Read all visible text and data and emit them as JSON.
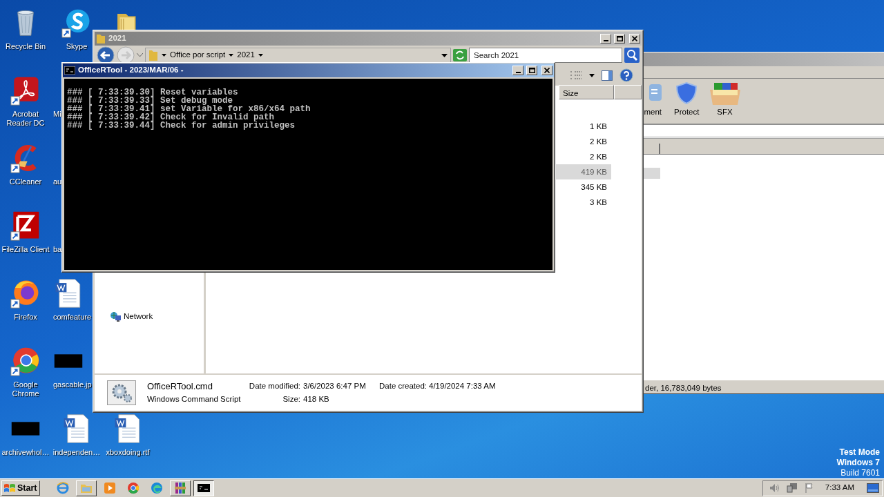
{
  "desktop": {
    "icons": [
      [
        {
          "label": "Recycle Bin",
          "kind": "recycle",
          "shortcut": false,
          "cut": false
        },
        {
          "label": "Skype",
          "kind": "skype",
          "shortcut": true,
          "cut": false
        },
        {
          "kind": "folder",
          "shortcut": false
        }
      ],
      [
        {
          "label": "Acrobat Reader DC",
          "kind": "acrobat",
          "shortcut": true,
          "cut": false
        },
        {
          "label": "Mi",
          "kind": "covered",
          "cut": true
        }
      ],
      [
        {
          "label": "CCleaner",
          "kind": "ccleaner",
          "shortcut": true,
          "cut": false
        },
        {
          "label": "au",
          "kind": "covered",
          "cut": true
        }
      ],
      [
        {
          "label": "FileZilla Client",
          "kind": "filezilla",
          "shortcut": true,
          "cut": false
        },
        {
          "label": "ba",
          "kind": "covered",
          "cut": true
        }
      ],
      [
        {
          "label": "Firefox",
          "kind": "firefox",
          "shortcut": true,
          "cut": false
        },
        {
          "label": "comfeature",
          "kind": "word",
          "shortcut": false,
          "cut": true
        }
      ],
      [
        {
          "label": "Google Chrome",
          "kind": "chrome",
          "shortcut": true,
          "cut": false
        },
        {
          "label": "gascable.jp",
          "kind": "black",
          "shortcut": false,
          "cut": true
        }
      ],
      [
        {
          "label": "archivewhol…",
          "kind": "black",
          "shortcut": false,
          "cut": false
        },
        {
          "label": "independen…",
          "kind": "word",
          "shortcut": false,
          "cut": false
        },
        {
          "label": "xboxdoing.rtf",
          "kind": "word",
          "shortcut": false,
          "cut": false
        }
      ]
    ],
    "system_text": [
      "Test Mode",
      "Windows 7",
      "Build 7601"
    ]
  },
  "background_window": {
    "toolbar": [
      {
        "label": "ment",
        "kind": "comment"
      },
      {
        "label": "Protect",
        "kind": "protect"
      },
      {
        "label": "SFX",
        "kind": "sfx"
      }
    ],
    "status_bar": "der, 16,783,049 bytes"
  },
  "explorer": {
    "title": "2021",
    "breadcrumb": [
      "Office por script",
      "2021"
    ],
    "search": {
      "placeholder": "Search 2021"
    },
    "columns": [
      "Size"
    ],
    "rows": [
      {
        "size": "1 KB",
        "selected": false
      },
      {
        "size": "2 KB",
        "selected": false
      },
      {
        "size": "2 KB",
        "selected": false
      },
      {
        "size": "419 KB",
        "selected": true
      },
      {
        "size": "345 KB",
        "selected": false
      },
      {
        "size": "3 KB",
        "selected": false
      }
    ],
    "nav": [
      "Network"
    ],
    "details": {
      "name": "OfficeRTool.cmd",
      "type": "Windows Command Script",
      "fields": [
        {
          "label": "Date modified:",
          "value": "3/6/2023 6:47 PM"
        },
        {
          "label": "Size:",
          "value": "418 KB"
        },
        {
          "label": "Date created:",
          "value": "4/19/2024 7:33 AM"
        }
      ]
    }
  },
  "console": {
    "title": "OfficeRTool - 2023/MAR/06 -",
    "lines": [
      "### [ 7:33:39.30] Reset variables",
      "### [ 7:33:39.33] Set debug mode",
      "### [ 7:33:39.41] set Variable for x86/x64 path",
      "### [ 7:33:39.42] Check for Invalid path",
      "### [ 7:33:39.44] Check for admin privileges"
    ]
  },
  "taskbar": {
    "start": "Start",
    "items": [
      {
        "kind": "ie",
        "running": false,
        "selected": false
      },
      {
        "kind": "explorer",
        "running": true,
        "selected": false
      },
      {
        "kind": "media",
        "running": false,
        "selected": false
      },
      {
        "kind": "chrome",
        "running": false,
        "selected": false
      },
      {
        "kind": "edge",
        "running": false,
        "selected": false
      },
      {
        "kind": "winrar",
        "running": true,
        "selected": false
      },
      {
        "kind": "cmd",
        "running": true,
        "selected": true
      }
    ],
    "clock": "7:33 AM"
  }
}
